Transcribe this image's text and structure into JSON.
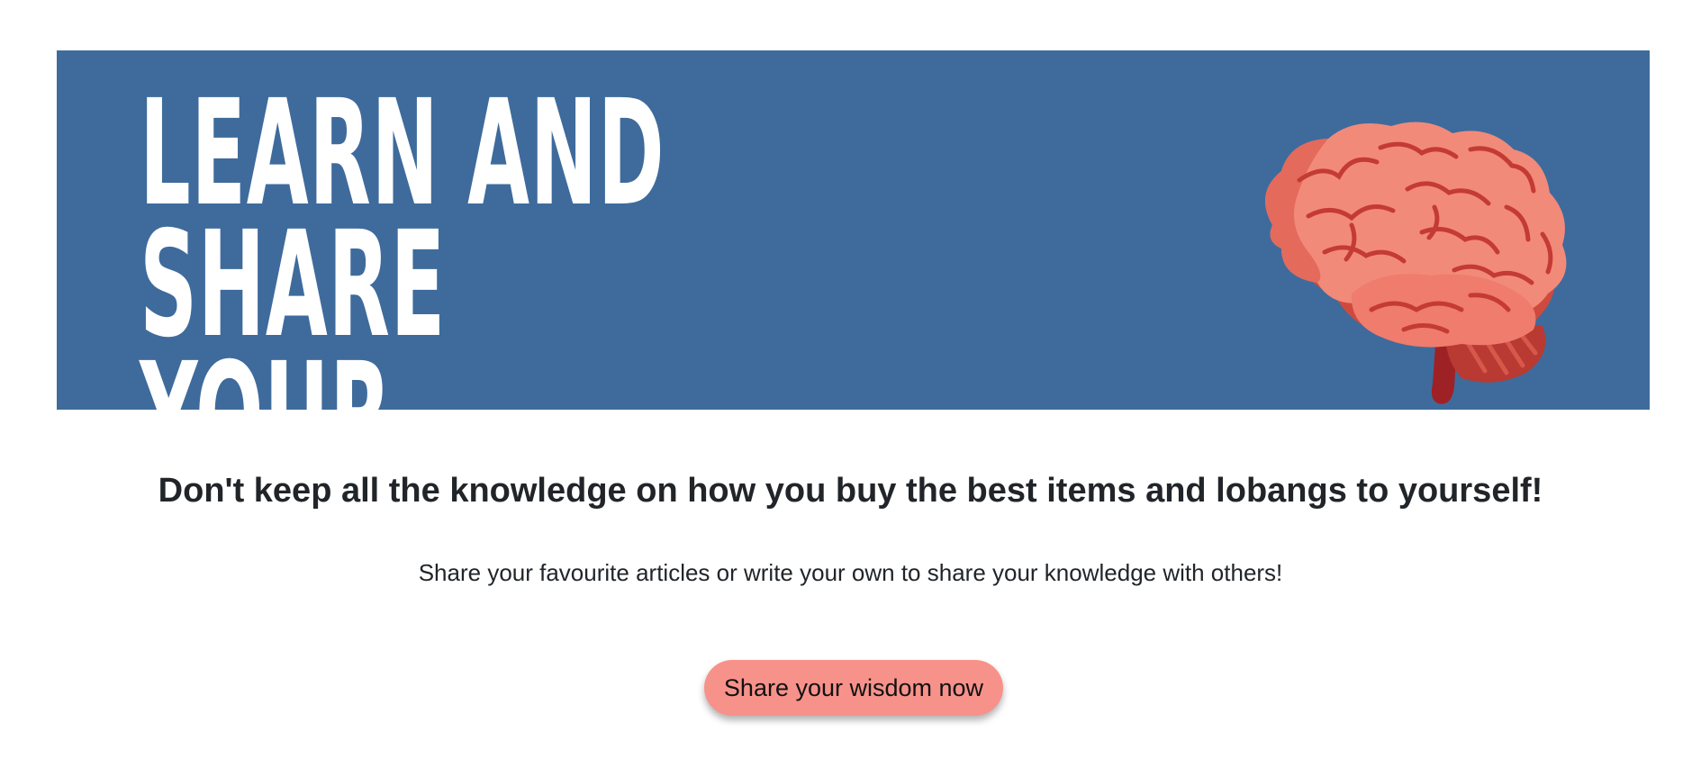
{
  "hero": {
    "title": "LEARN AND SHARE YOUR\nWISDOM!",
    "background_color": "#3e6b9c",
    "image_icon": "brain-icon"
  },
  "main": {
    "headline": "Don't keep all the knowledge on how you buy the best items and lobangs to yourself!",
    "subtext": "Share your favourite articles or write your own to share your knowledge with others!",
    "cta_label": "Share your wisdom now",
    "cta_color": "#f7928a"
  }
}
